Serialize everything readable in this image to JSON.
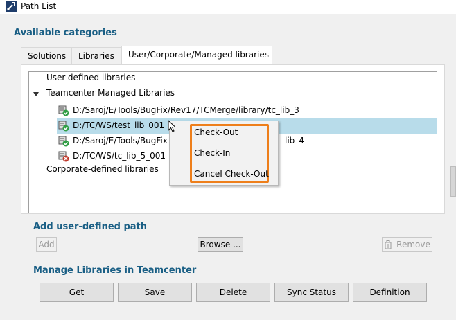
{
  "window": {
    "title": "Path List",
    "app_icon": "wrench-icon"
  },
  "categories_heading": "Available categories",
  "tabs": [
    {
      "label": "Solutions",
      "active": false
    },
    {
      "label": "Libraries",
      "active": false
    },
    {
      "label": "User/Corporate/Managed libraries",
      "active": true
    }
  ],
  "tree": {
    "user_defined": "User-defined libraries",
    "teamcenter_node": "Teamcenter Managed Libraries",
    "expand_icon": "triangle-down-icon",
    "libraries": [
      {
        "path": "D:/Saroj/E/Tools/BugFix/Rev17/TCMerge/library/tc_lib_3",
        "status": "checked-in",
        "icon": "library-green-check-icon",
        "selected": false
      },
      {
        "path": "D:/TC/WS/test_lib_001",
        "status": "checked-in",
        "icon": "library-green-check-icon",
        "selected": true
      },
      {
        "path": "D:/Saroj/E/Tools/BugFix",
        "suffix": "_lib_4",
        "status": "checked-in",
        "icon": "library-green-check-icon",
        "selected": false
      },
      {
        "path": "D:/TC/WS/tc_lib_5_001",
        "status": "error",
        "icon": "library-red-x-icon",
        "selected": false
      }
    ],
    "corporate_defined": "Corporate-defined libraries"
  },
  "context_menu": {
    "items": [
      "Check-Out",
      "Check-In",
      "Cancel Check-Out"
    ],
    "highlight_color": "#ee7f1b"
  },
  "add_path": {
    "heading": "Add user-defined path",
    "add_label": "Add",
    "path_value": "",
    "browse_label": "Browse ...",
    "remove_label": "Remove",
    "remove_icon": "trash-icon"
  },
  "manage": {
    "heading": "Manage Libraries in Teamcenter",
    "buttons": [
      "Get",
      "Save",
      "Delete",
      "Sync Status",
      "Definition"
    ]
  },
  "colors": {
    "heading": "#1a5f85",
    "selection": "#b8dcea"
  }
}
